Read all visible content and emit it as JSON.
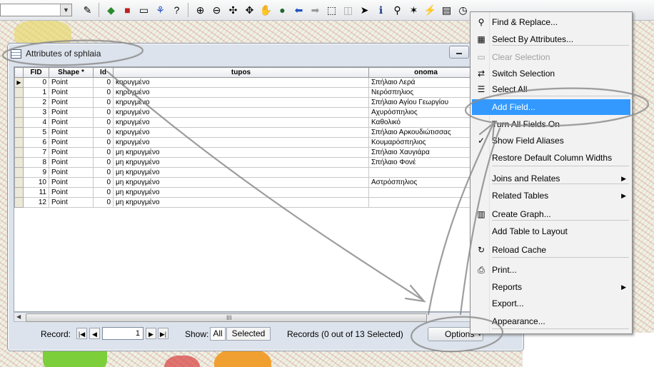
{
  "toolbar": {
    "combo_value": "",
    "icons": [
      "editor-icon",
      "add-data-icon",
      "toolbox-icon",
      "window-icon",
      "arcscene-icon",
      "whats-this-icon",
      "zoom-in-icon",
      "zoom-out-icon",
      "fixed-zoom-in-icon",
      "fixed-zoom-out-icon",
      "pan-icon",
      "full-extent-icon",
      "back-icon",
      "forward-icon",
      "select-features-icon",
      "clear-selected-icon",
      "select-elements-icon",
      "identify-icon",
      "find-icon",
      "measure-icon",
      "hyperlink-icon",
      "html-popup-icon",
      "time-slider-icon"
    ]
  },
  "attributes_window": {
    "title": "Attributes of sphlaia",
    "columns": [
      "FID",
      "Shape *",
      "Id",
      "tupos",
      "onoma"
    ],
    "rows": [
      {
        "fid": "0",
        "shape": "Point",
        "id": "0",
        "tupos": "κηρυγμένο",
        "onoma": "Σπήλαιο Λερά"
      },
      {
        "fid": "1",
        "shape": "Point",
        "id": "0",
        "tupos": "κηρυγμένο",
        "onoma": "Νερόσπηλιος"
      },
      {
        "fid": "2",
        "shape": "Point",
        "id": "0",
        "tupos": "κηρυγμένο",
        "onoma": "Σπήλαιο Αγίου Γεωργίου"
      },
      {
        "fid": "3",
        "shape": "Point",
        "id": "0",
        "tupos": "κηρυγμένο",
        "onoma": "Αχυρόσπηλιος"
      },
      {
        "fid": "4",
        "shape": "Point",
        "id": "0",
        "tupos": "κηρυγμένο",
        "onoma": "Καθολικό"
      },
      {
        "fid": "5",
        "shape": "Point",
        "id": "0",
        "tupos": "κηρυγμένο",
        "onoma": "Σπήλαιο Αρκουδιώτισσας"
      },
      {
        "fid": "6",
        "shape": "Point",
        "id": "0",
        "tupos": "κηρυγμένο",
        "onoma": "Κουμαρόσπηλιος"
      },
      {
        "fid": "7",
        "shape": "Point",
        "id": "0",
        "tupos": "μη κηρυγμένο",
        "onoma": "Σπήλαιο Χαυγιάρα"
      },
      {
        "fid": "8",
        "shape": "Point",
        "id": "0",
        "tupos": "μη κηρυγμένο",
        "onoma": "Σπήλαιο Φονέ"
      },
      {
        "fid": "9",
        "shape": "Point",
        "id": "0",
        "tupos": "μη κηρυγμένο",
        "onoma": ""
      },
      {
        "fid": "10",
        "shape": "Point",
        "id": "0",
        "tupos": "μη κηρυγμένο",
        "onoma": "Αστρόσπηλιος"
      },
      {
        "fid": "11",
        "shape": "Point",
        "id": "0",
        "tupos": "μη κηρυγμένο",
        "onoma": ""
      },
      {
        "fid": "12",
        "shape": "Point",
        "id": "0",
        "tupos": "μη κηρυγμένο",
        "onoma": ""
      }
    ],
    "scroll_grip": "III",
    "status": {
      "record_label": "Record:",
      "record_value": "1",
      "show_label": "Show:",
      "show_all": "All",
      "show_selected": "Selected",
      "records_text": "Records (0 out of 13 Selected)",
      "options_label": "Options"
    }
  },
  "menu": {
    "items": [
      {
        "label": "Find & Replace...",
        "icon": "binoculars-icon",
        "state": "normal"
      },
      {
        "label": "Select By Attributes...",
        "icon": "sql-icon",
        "state": "normal"
      },
      {
        "label": "Clear Selection",
        "icon": "clear-selection-icon",
        "state": "disabled"
      },
      {
        "label": "Switch Selection",
        "icon": "switch-selection-icon",
        "state": "normal"
      },
      {
        "label": "Select All",
        "icon": "select-all-icon",
        "state": "normal"
      },
      {
        "label": "Add Field...",
        "icon": "",
        "state": "highlighted"
      },
      {
        "label": "Turn All Fields On",
        "icon": "",
        "state": "normal"
      },
      {
        "label": "Show Field Aliases",
        "icon": "check-icon",
        "state": "checked"
      },
      {
        "label": "Restore Default Column Widths",
        "icon": "",
        "state": "normal"
      },
      {
        "label": "Joins and Relates",
        "icon": "",
        "state": "submenu"
      },
      {
        "label": "Related Tables",
        "icon": "",
        "state": "submenu"
      },
      {
        "label": "Create Graph...",
        "icon": "graph-icon",
        "state": "normal"
      },
      {
        "label": "Add Table to Layout",
        "icon": "",
        "state": "normal"
      },
      {
        "label": "Reload Cache",
        "icon": "reload-icon",
        "state": "normal"
      },
      {
        "label": "Print...",
        "icon": "printer-icon",
        "state": "normal"
      },
      {
        "label": "Reports",
        "icon": "",
        "state": "submenu"
      },
      {
        "label": "Export...",
        "icon": "",
        "state": "normal"
      },
      {
        "label": "Appearance...",
        "icon": "",
        "state": "normal"
      }
    ]
  },
  "colors": {
    "highlight": "#3399ff",
    "window_bg": "#dde3ec",
    "annotation": "#8c8c8c"
  }
}
